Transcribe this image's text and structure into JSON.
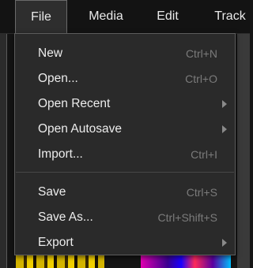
{
  "menubar": {
    "items": [
      {
        "label": "File",
        "active": true
      },
      {
        "label": "Media",
        "active": false
      },
      {
        "label": "Edit",
        "active": false
      },
      {
        "label": "Track",
        "active": false
      }
    ]
  },
  "file_menu": {
    "items": [
      {
        "label": "New",
        "shortcut": "Ctrl+N"
      },
      {
        "label": "Open...",
        "shortcut": "Ctrl+O"
      },
      {
        "label": "Open Recent",
        "submenu_icon": "chevron-right-icon"
      },
      {
        "label": "Open Autosave",
        "submenu_icon": "chevron-right-icon"
      },
      {
        "label": "Import...",
        "shortcut": "Ctrl+I"
      },
      {
        "label": "Save",
        "shortcut": "Ctrl+S"
      },
      {
        "label": "Save As...",
        "shortcut": "Ctrl+Shift+S"
      },
      {
        "label": "Export",
        "submenu_icon": "chevron-right-icon"
      }
    ]
  },
  "colors": {
    "menu_background": "#2a2a2a",
    "menubar_background": "#131313",
    "text": "#ececec",
    "shortcut_text": "#7b7b7b"
  }
}
